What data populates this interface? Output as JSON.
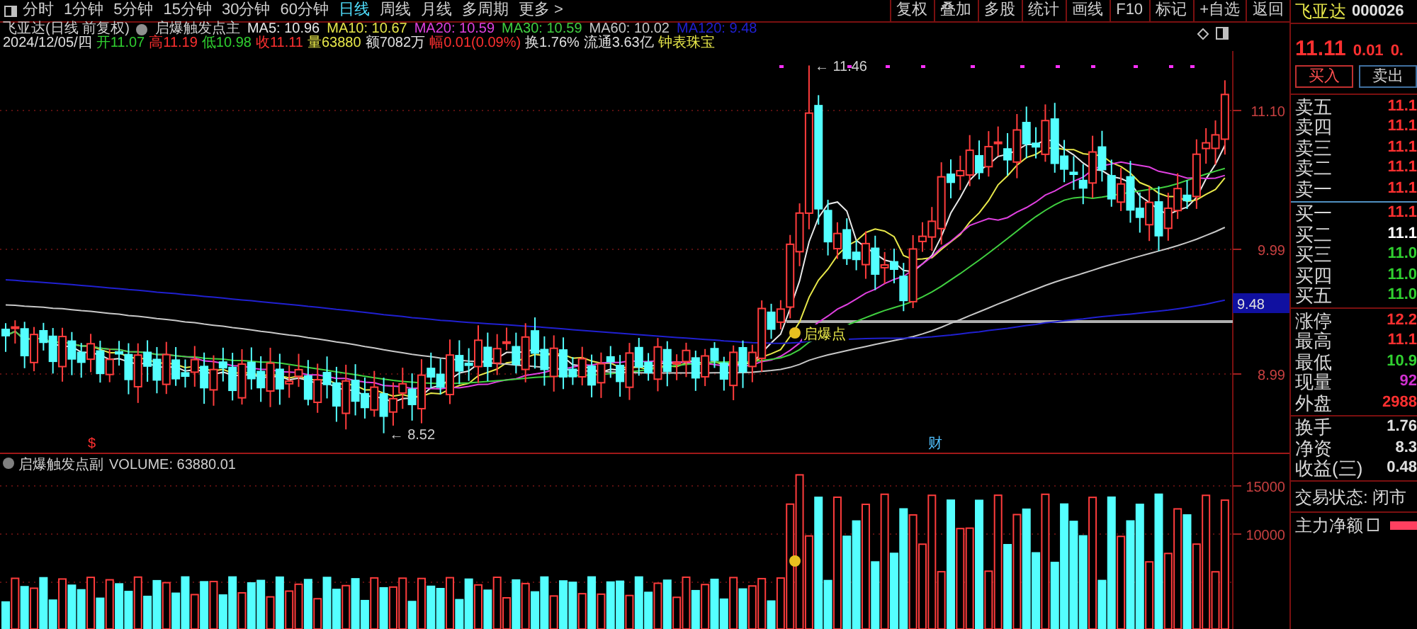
{
  "toolbar": {
    "periods": [
      {
        "label": "分时",
        "selected": false
      },
      {
        "label": "1分钟",
        "selected": false
      },
      {
        "label": "5分钟",
        "selected": false
      },
      {
        "label": "15分钟",
        "selected": false
      },
      {
        "label": "30分钟",
        "selected": false
      },
      {
        "label": "60分钟",
        "selected": false
      },
      {
        "label": "日线",
        "selected": true
      },
      {
        "label": "周线",
        "selected": false
      },
      {
        "label": "月线",
        "selected": false
      },
      {
        "label": "多周期",
        "selected": false
      }
    ],
    "more": "更多 >",
    "tools": [
      "复权",
      "叠加",
      "多股",
      "统计",
      "画线",
      "F10",
      "标记",
      "+自选",
      "返回"
    ]
  },
  "main_chart": {
    "title": "飞亚达(日线 前复权)",
    "indicator": "启爆触发点主",
    "ma": [
      {
        "label": "MA5: 10.96",
        "color": "#e8e8e8"
      },
      {
        "label": "MA10: 10.67",
        "color": "#e8e84a"
      },
      {
        "label": "MA20: 10.59",
        "color": "#e040e0"
      },
      {
        "label": "MA30: 10.59",
        "color": "#40d040"
      },
      {
        "label": "MA60: 10.02",
        "color": "#c8c8c8"
      },
      {
        "label": "MA120: 9.48",
        "color": "#2020d0"
      }
    ],
    "quote": [
      {
        "text": "2024/12/05/四",
        "color": "#e0e0e0"
      },
      {
        "text": "开11.07",
        "color": "#30d030"
      },
      {
        "text": "高11.19",
        "color": "#ff3030"
      },
      {
        "text": "低10.98",
        "color": "#30d030"
      },
      {
        "text": "收11.11",
        "color": "#ff3030"
      },
      {
        "text": "量63880",
        "color": "#e8e84a"
      },
      {
        "text": "额7082万",
        "color": "#e0e0e0"
      },
      {
        "text": "幅0.01(0.09%)",
        "color": "#ff3030"
      },
      {
        "text": "换1.76%",
        "color": "#e0e0e0"
      },
      {
        "text": "流通3.63亿",
        "color": "#e0e0e0"
      },
      {
        "text": "钟表珠宝",
        "color": "#e8e84a"
      }
    ],
    "price_axis": [
      "11.10",
      "9.99",
      "8.99"
    ],
    "current_price_tag": "9.48",
    "high_label": "← 11.46",
    "low_label": "← 8.52",
    "signal_label": "启爆点",
    "dollar_mark": "$",
    "news_mark": "财"
  },
  "volume_chart": {
    "title": "启爆触发点副",
    "reading": "VOLUME: 63880.01",
    "axis": [
      "15000",
      "10000"
    ]
  },
  "quote_panel": {
    "name": "飞亚达",
    "code": "000026",
    "price": "11.11",
    "change": "0.01",
    "change_pct": "0.",
    "buy_button": "买入",
    "sell_button": "卖出",
    "asks": [
      {
        "label": "卖五",
        "price": "11.1",
        "color": "#ff3030"
      },
      {
        "label": "卖四",
        "price": "11.1",
        "color": "#ff3030"
      },
      {
        "label": "卖三",
        "price": "11.1",
        "color": "#ff3030"
      },
      {
        "label": "卖二",
        "price": "11.1",
        "color": "#ff3030"
      },
      {
        "label": "卖一",
        "price": "11.1",
        "color": "#ff3030"
      }
    ],
    "bids": [
      {
        "label": "买一",
        "price": "11.1",
        "color": "#ff3030"
      },
      {
        "label": "买二",
        "price": "11.1",
        "color": "#ffffff"
      },
      {
        "label": "买三",
        "price": "11.0",
        "color": "#30d030"
      },
      {
        "label": "买四",
        "price": "11.0",
        "color": "#30d030"
      },
      {
        "label": "买五",
        "price": "11.0",
        "color": "#30d030"
      }
    ],
    "stats": [
      {
        "label": "涨停",
        "value": "12.2",
        "color": "#ff3030"
      },
      {
        "label": "最高",
        "value": "11.1",
        "color": "#ff3030"
      },
      {
        "label": "最低",
        "value": "10.9",
        "color": "#30d030"
      },
      {
        "label": "现量",
        "value": "92",
        "color": "#d030d0"
      },
      {
        "label": "外盘",
        "value": "2988",
        "color": "#ff3030"
      }
    ],
    "fundamentals": [
      {
        "label": "换手",
        "value": "1.76"
      },
      {
        "label": "净资",
        "value": "8.3"
      },
      {
        "label": "收益(三)",
        "value": "0.48"
      }
    ],
    "trade_status": "交易状态: 闭市",
    "main_net": "主力净额"
  }
}
